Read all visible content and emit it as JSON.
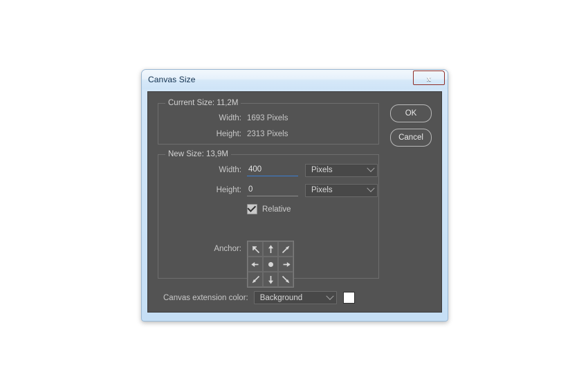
{
  "window": {
    "title": "Canvas Size",
    "close_glyph": "x"
  },
  "current_size": {
    "legend": "Current Size: 11,2M",
    "width_label": "Width:",
    "width_value": "1693 Pixels",
    "height_label": "Height:",
    "height_value": "2313 Pixels"
  },
  "new_size": {
    "legend": "New Size: 13,9M",
    "width_label": "Width:",
    "width_value": "400",
    "width_unit": "Pixels",
    "height_label": "Height:",
    "height_value": "0",
    "height_unit": "Pixels",
    "relative_label": "Relative",
    "relative_checked": true,
    "anchor_label": "Anchor:",
    "anchor_selected": "center"
  },
  "extension": {
    "label": "Canvas extension color:",
    "value": "Background",
    "swatch_color": "#ffffff"
  },
  "buttons": {
    "ok": "OK",
    "cancel": "Cancel"
  },
  "colors": {
    "dialog_background": "#535353",
    "frame": "#c6dff5",
    "focus_underline": "#3b7fd4",
    "close_button": "#c7463f"
  },
  "anchor_cells": [
    {
      "name": "anchor-top-left",
      "icon": "arrow-up-left-icon"
    },
    {
      "name": "anchor-top-center",
      "icon": "arrow-up-icon"
    },
    {
      "name": "anchor-top-right",
      "icon": "arrow-up-right-icon"
    },
    {
      "name": "anchor-middle-left",
      "icon": "arrow-left-icon"
    },
    {
      "name": "anchor-center",
      "icon": "center-dot-icon"
    },
    {
      "name": "anchor-middle-right",
      "icon": "arrow-right-icon"
    },
    {
      "name": "anchor-bottom-left",
      "icon": "arrow-down-left-icon"
    },
    {
      "name": "anchor-bottom-center",
      "icon": "arrow-down-icon"
    },
    {
      "name": "anchor-bottom-right",
      "icon": "arrow-down-right-icon"
    }
  ]
}
